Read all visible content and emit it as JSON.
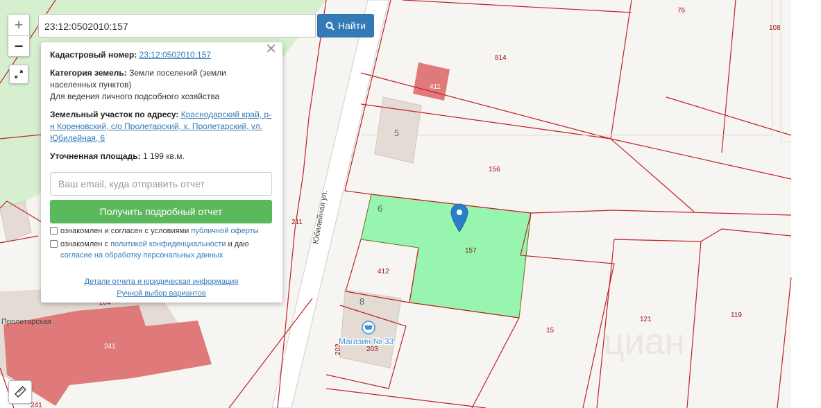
{
  "search": {
    "value": "23:12:0502010:157",
    "button_label": "Найти"
  },
  "popup": {
    "cad_label": "Кадастровый номер:",
    "cad_value": "23:12:0502010:157",
    "category_label": "Категория земель:",
    "category_value": "Земли поселений (земли населенных пунктов)",
    "usage": "Для ведения личного подсобного хозяйства",
    "address_label": "Земельный участок по адресу:",
    "address_value": "Краснодарский край, р-н Кореновский, с/о Пролетарский, х. Пролетарский, ул. Юбилейная, 6",
    "area_label": "Уточненная площадь:",
    "area_value": "1 199 кв.м.",
    "email_placeholder": "Ваш email, куда отправить отчет",
    "report_button": "Получить подробный отчет",
    "check1_text": "ознакомлен и согласен с условиями",
    "check1_link": "публичной оферты",
    "check2_text1": "ознакомлен с",
    "check2_link1": "политикой конфиденциальности",
    "check2_text2": "и даю",
    "check2_link2": "согласие на обработку персональных данных",
    "details_link": "Детали отчета и юридическая информация",
    "manual_link": "Ручной выбор вариантов"
  },
  "map": {
    "plots": {
      "p76": "76",
      "p108": "108",
      "p814": "814",
      "p411": "411",
      "p156": "156",
      "p157": "157",
      "p211": "211",
      "p412": "412",
      "p15": "15",
      "p121": "121",
      "p119": "119",
      "p203a": "203",
      "p203b": "203",
      "p204": "204",
      "p241": "241",
      "p241b": "241"
    },
    "houses": {
      "h5": "5",
      "h6": "6",
      "h8": "8"
    },
    "street_yub": "Юбилейная ул.",
    "street_prol": "Пролетарская",
    "shop_label": "Магазин № 33",
    "watermark": "циан",
    "selected_color": "#98f5b0",
    "building_red": "#e07a7a"
  }
}
